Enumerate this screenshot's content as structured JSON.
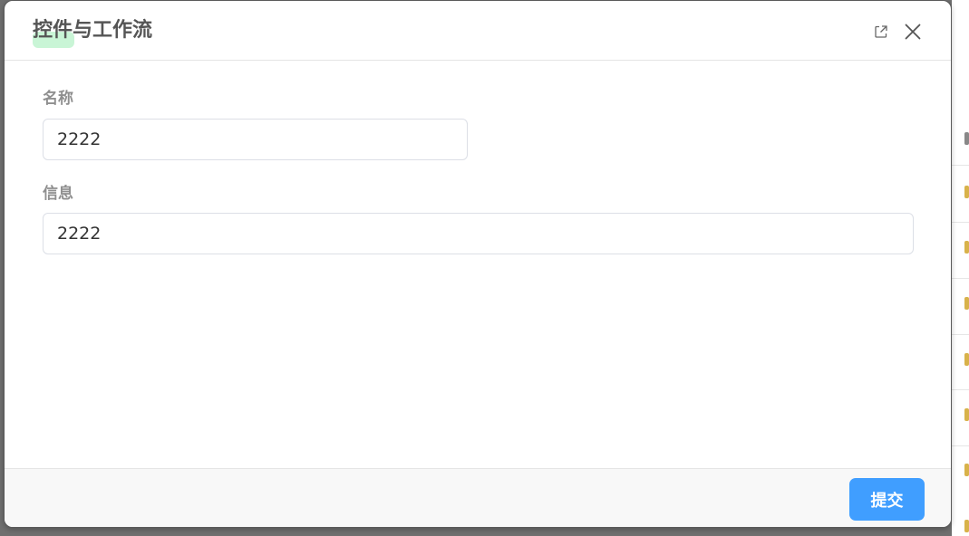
{
  "dialog": {
    "title": "控件与工作流",
    "open_icon": "external-link-icon",
    "close_icon": "close-icon"
  },
  "form": {
    "name_label": "名称",
    "name_value": "2222",
    "info_label": "信息",
    "info_value": "2222"
  },
  "footer": {
    "submit_label": "提交"
  },
  "colors": {
    "primary": "#409eff",
    "title_highlight": "#c9f5d6",
    "overlay": "#6f6f6f"
  }
}
